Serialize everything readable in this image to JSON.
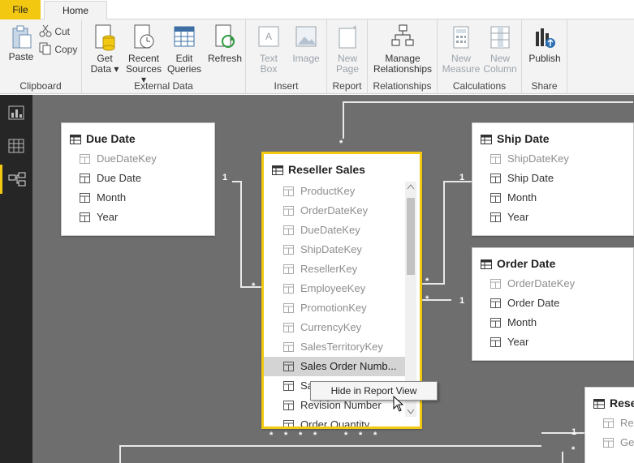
{
  "tabs": {
    "file": "File",
    "home": "Home"
  },
  "ribbon": {
    "clipboard": {
      "paste": "Paste",
      "cut": "Cut",
      "copy": "Copy",
      "label": "Clipboard"
    },
    "external_data": {
      "get_data": "Get Data ▾",
      "get_data_1": "Get",
      "get_data_2": "Data ▾",
      "recent_1": "Recent",
      "recent_2": "Sources ▾",
      "edit_1": "Edit",
      "edit_2": "Queries",
      "refresh": "Refresh",
      "label": "External Data"
    },
    "insert": {
      "text_1": "Text",
      "text_2": "Box",
      "image": "Image",
      "label": "Insert"
    },
    "report": {
      "new_1": "New",
      "new_2": "Page",
      "label": "Report"
    },
    "relationships": {
      "manage_1": "Manage",
      "manage_2": "Relationships",
      "label": "Relationships"
    },
    "calculations": {
      "measure_1": "New",
      "measure_2": "Measure",
      "column_1": "New",
      "column_2": "Column",
      "label": "Calculations"
    },
    "share": {
      "publish": "Publish",
      "label": "Share"
    }
  },
  "tables": {
    "due_date": {
      "title": "Due Date",
      "fields": [
        "DueDateKey",
        "Due Date",
        "Month",
        "Year"
      ]
    },
    "ship_date": {
      "title": "Ship Date",
      "fields": [
        "ShipDateKey",
        "Ship Date",
        "Month",
        "Year"
      ]
    },
    "order_date": {
      "title": "Order Date",
      "fields": [
        "OrderDateKey",
        "Order Date",
        "Month",
        "Year"
      ]
    },
    "reseller_sales": {
      "title": "Reseller Sales",
      "fields": [
        "ProductKey",
        "OrderDateKey",
        "DueDateKey",
        "ShipDateKey",
        "ResellerKey",
        "EmployeeKey",
        "PromotionKey",
        "CurrencyKey",
        "SalesTerritoryKey",
        "Sales Order Numb...",
        "Sa",
        "Revision Number",
        "Order Quantity"
      ]
    },
    "reseller_partial": {
      "title": "Rese",
      "fields": [
        "Re",
        "Ge"
      ]
    }
  },
  "relationships": {
    "one": "1",
    "many": "*"
  },
  "context_menu": {
    "hide": "Hide in Report View"
  },
  "colors": {
    "accent": "#f2c811",
    "canvas": "#6e6e6e",
    "sidebar": "#262626"
  }
}
